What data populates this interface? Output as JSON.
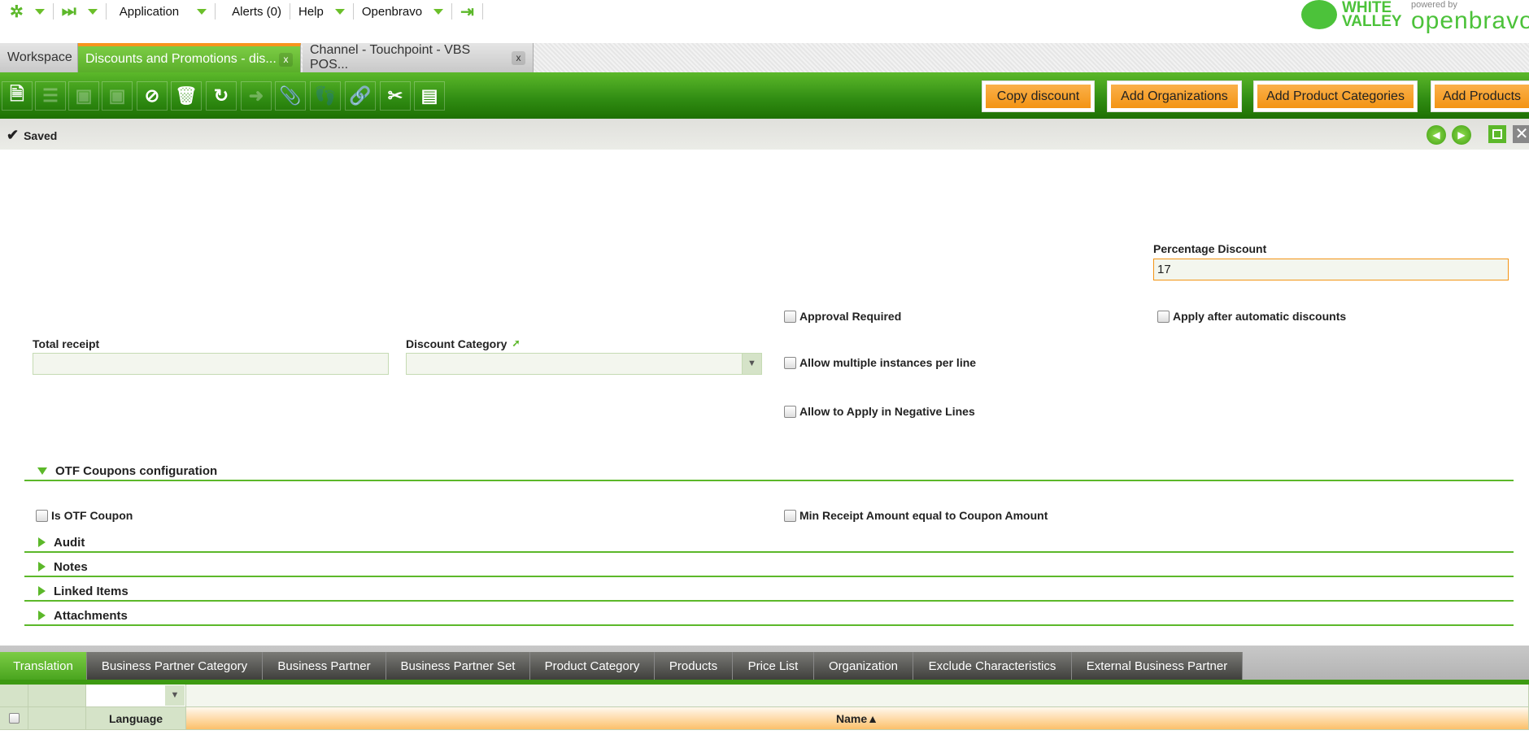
{
  "topnav": {
    "application": "Application",
    "alerts": "Alerts (0)",
    "help": "Help",
    "user": "Openbravo"
  },
  "logos": {
    "white_valley_1": "WHITE",
    "white_valley_2": "VALLEY",
    "powered_by": "powered by",
    "openbravo": "openbravo"
  },
  "tabs": [
    {
      "label": "Workspace"
    },
    {
      "label": "Discounts and Promotions - dis...",
      "close": "x"
    },
    {
      "label": "Channel - Touchpoint - VBS POS...",
      "close": "x"
    }
  ],
  "actions": {
    "copy": "Copy discount",
    "add_orgs": "Add Organizations",
    "add_cats": "Add Product Categories",
    "add_products": "Add Products"
  },
  "status": {
    "text": "Saved"
  },
  "form": {
    "percentage_label": "Percentage Discount",
    "percentage_value": "17",
    "approval": "Approval Required",
    "apply_after": "Apply after automatic discounts",
    "total_receipt_label": "Total receipt",
    "total_receipt_value": "",
    "discount_category_label": "Discount Category",
    "discount_category_value": "",
    "allow_multiple": "Allow multiple instances per line",
    "allow_negative": "Allow to Apply in Negative Lines",
    "otf_section": "OTF Coupons configuration",
    "is_otf": "Is OTF Coupon",
    "min_receipt": "Min Receipt Amount equal to Coupon Amount",
    "sections": [
      "Audit",
      "Notes",
      "Linked Items",
      "Attachments"
    ]
  },
  "subtabs": [
    "Translation",
    "Business Partner Category",
    "Business Partner",
    "Business Partner Set",
    "Product Category",
    "Products",
    "Price List",
    "Organization",
    "Exclude Characteristics",
    "External Business Partner"
  ],
  "grid": {
    "col_language": "Language",
    "col_name": "Name",
    "sort_indicator": "▲"
  },
  "colors": {
    "green": "#5cb82a",
    "orange": "#f39414"
  }
}
